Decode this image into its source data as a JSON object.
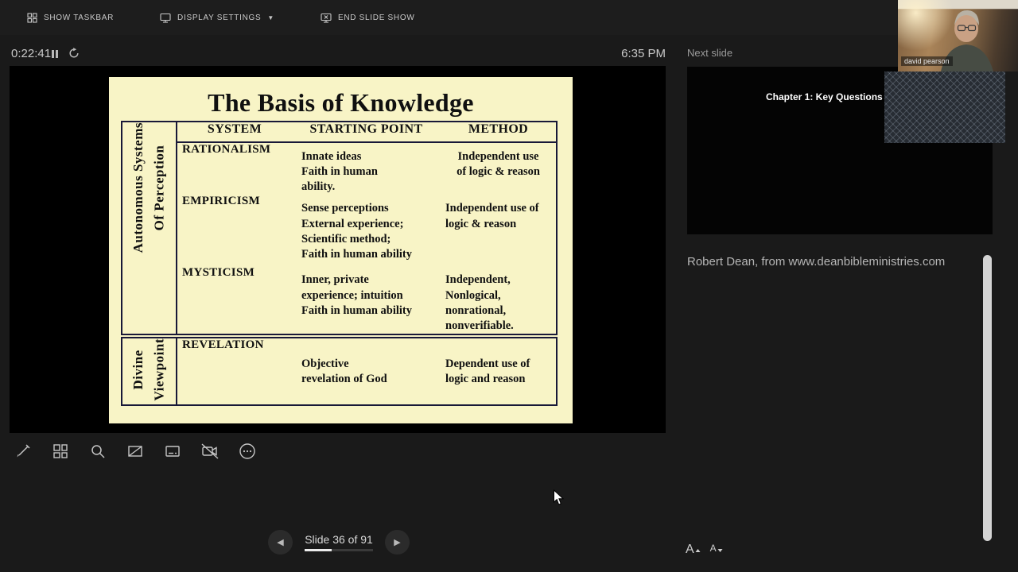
{
  "topbar": {
    "show_taskbar": "SHOW TASKBAR",
    "display_settings": "DISPLAY SETTINGS",
    "display_settings_caret": "▼",
    "end_slide_show": "END SLIDE SHOW"
  },
  "presenter": {
    "timer": "0:22:41",
    "clock": "6:35 PM",
    "slide_label": "Slide 36 of 91",
    "slide_current": 36,
    "slide_total": 91
  },
  "nav_icons": {
    "prev": "◀",
    "next": "▶"
  },
  "slide": {
    "title": "The Basis of Knowledge",
    "columns": [
      "SYSTEM",
      "STARTING POINT",
      "METHOD"
    ],
    "group_top": "Autonomous Systems\nOf Perception",
    "group_bottom": "Divine\nViewpoint",
    "rows": [
      {
        "system": "RATIONALISM",
        "starting_point": "Innate ideas\nFaith in human\nability.",
        "method": "Independent use\nof logic & reason"
      },
      {
        "system": "EMPIRICISM",
        "starting_point": "Sense perceptions\nExternal experience;\nScientific method;\nFaith in human ability",
        "method": "Independent use of\nlogic & reason"
      },
      {
        "system": "MYSTICISM",
        "starting_point": "Inner, private\nexperience; intuition\nFaith in human ability",
        "method": "Independent,\nNonlogical,\nnonrational,\nnonverifiable."
      },
      {
        "system": "REVELATION",
        "starting_point": "Objective\nrevelation of God",
        "method": "Dependent use of\nlogic and reason"
      }
    ]
  },
  "next_slide": {
    "label": "Next slide",
    "thumbnail_title": "Chapter 1: Key Questions"
  },
  "notes": {
    "text": "Robert Dean, from www.deanbibleministries.com"
  },
  "webcam": {
    "name": "david pearson"
  },
  "font_controls": {
    "increase_label": "A",
    "decrease_label": "A"
  }
}
